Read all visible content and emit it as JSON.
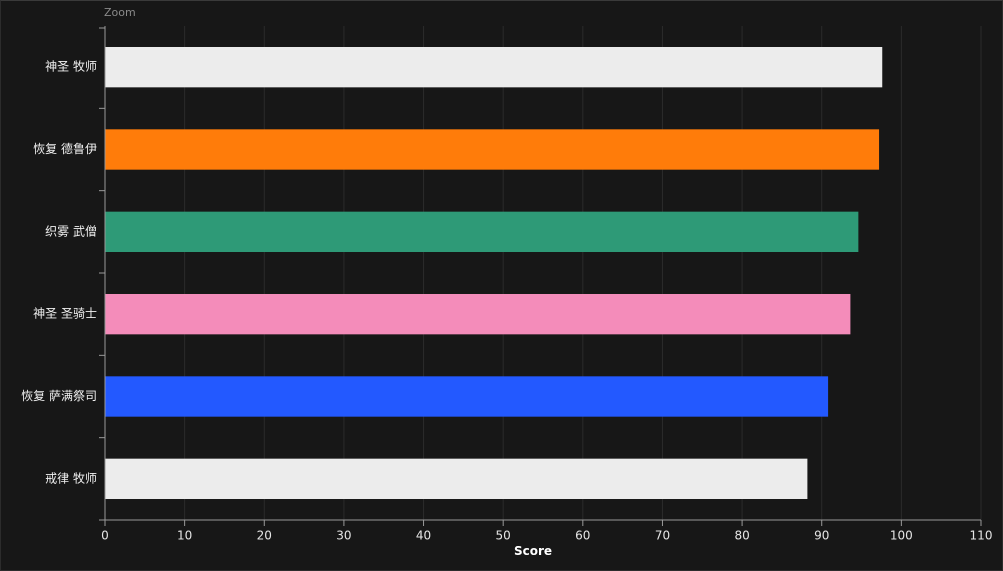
{
  "toolbar": {
    "zoom_label": "Zoom"
  },
  "chart_data": {
    "type": "bar",
    "orientation": "horizontal",
    "categories": [
      "神圣 牧师",
      "恢复 德鲁伊",
      "织雾 武僧",
      "神圣 圣骑士",
      "恢复 萨满祭司",
      "戒律 牧师"
    ],
    "values": [
      97.6,
      97.2,
      94.6,
      93.6,
      90.8,
      88.2
    ],
    "colors": [
      "#ececec",
      "#ff7c0a",
      "#2e9a77",
      "#f48cba",
      "#2359ff",
      "#ececec"
    ],
    "xlabel": "Score",
    "ylabel": "",
    "xlim": [
      0,
      110
    ],
    "xticks": [
      "0",
      "10",
      "20",
      "30",
      "40",
      "50",
      "60",
      "70",
      "80",
      "90",
      "100",
      "110"
    ],
    "grid": true,
    "legend": "none"
  }
}
